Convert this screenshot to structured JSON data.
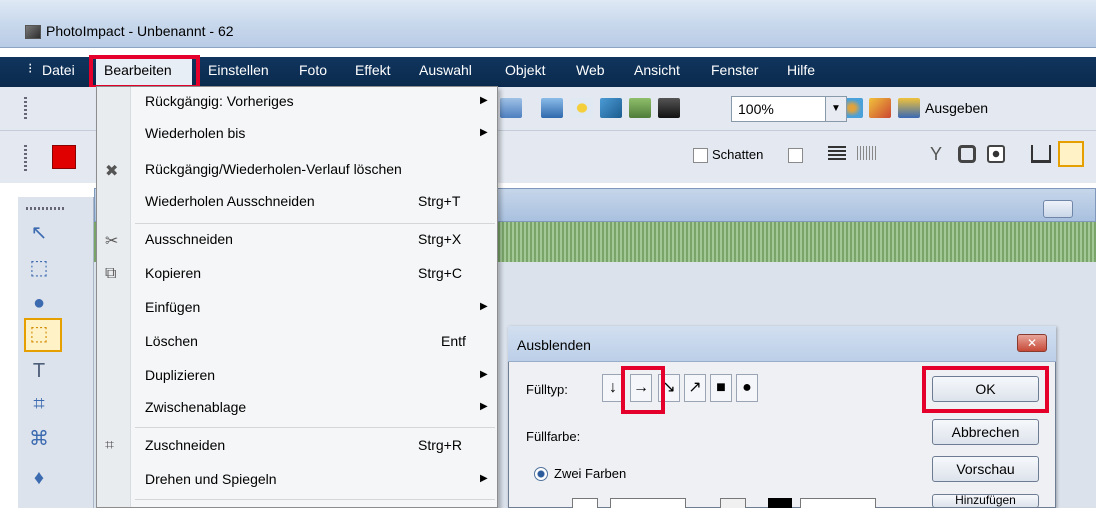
{
  "window": {
    "title": "PhotoImpact - Unbenannt - 62"
  },
  "menubar": {
    "items": [
      "Datei",
      "Bearbeiten",
      "Einstellen",
      "Foto",
      "Effekt",
      "Auswahl",
      "Objekt",
      "Web",
      "Ansicht",
      "Fenster",
      "Hilfe"
    ]
  },
  "toolbar": {
    "zoom": "100%",
    "ausgeben": "Ausgeben",
    "schatten": "Schatten"
  },
  "edit_menu": {
    "items": [
      {
        "label": "Rückgängig: Vorheriges",
        "shortcut": "",
        "submenu": true
      },
      {
        "label": "Wiederholen bis",
        "shortcut": "",
        "submenu": true
      },
      {
        "label": "Rückgängig/Wiederholen-Verlauf löschen",
        "shortcut": "",
        "submenu": false
      },
      {
        "label": "Wiederholen Ausschneiden",
        "shortcut": "Strg+T",
        "submenu": false
      },
      {
        "label": "Ausschneiden",
        "shortcut": "Strg+X",
        "submenu": false
      },
      {
        "label": "Kopieren",
        "shortcut": "Strg+C",
        "submenu": false
      },
      {
        "label": "Einfügen",
        "shortcut": "",
        "submenu": true
      },
      {
        "label": "Löschen",
        "shortcut": "Entf",
        "submenu": false
      },
      {
        "label": "Duplizieren",
        "shortcut": "",
        "submenu": true
      },
      {
        "label": "Zwischenablage",
        "shortcut": "",
        "submenu": true
      },
      {
        "label": "Zuschneiden",
        "shortcut": "Strg+R",
        "submenu": false
      },
      {
        "label": "Drehen und Spiegeln",
        "shortcut": "",
        "submenu": true
      }
    ],
    "submenu_arrow": "▶"
  },
  "dialog": {
    "title": "Ausblenden",
    "close": "✕",
    "filltype_label": "Fülltyp:",
    "filltype_buttons": [
      "↓",
      "→",
      "↘",
      "↗",
      "■",
      "●"
    ],
    "fillcolor_label": "Füllfarbe:",
    "radio_label": "Zwei Farben",
    "buttons": {
      "ok": "OK",
      "cancel": "Abbrechen",
      "preview": "Vorschau",
      "add": "Hinzufügen"
    }
  },
  "colors": {
    "menubar": "#10355e",
    "highlight": "#e4002b",
    "foreground_color": "#e00000"
  }
}
